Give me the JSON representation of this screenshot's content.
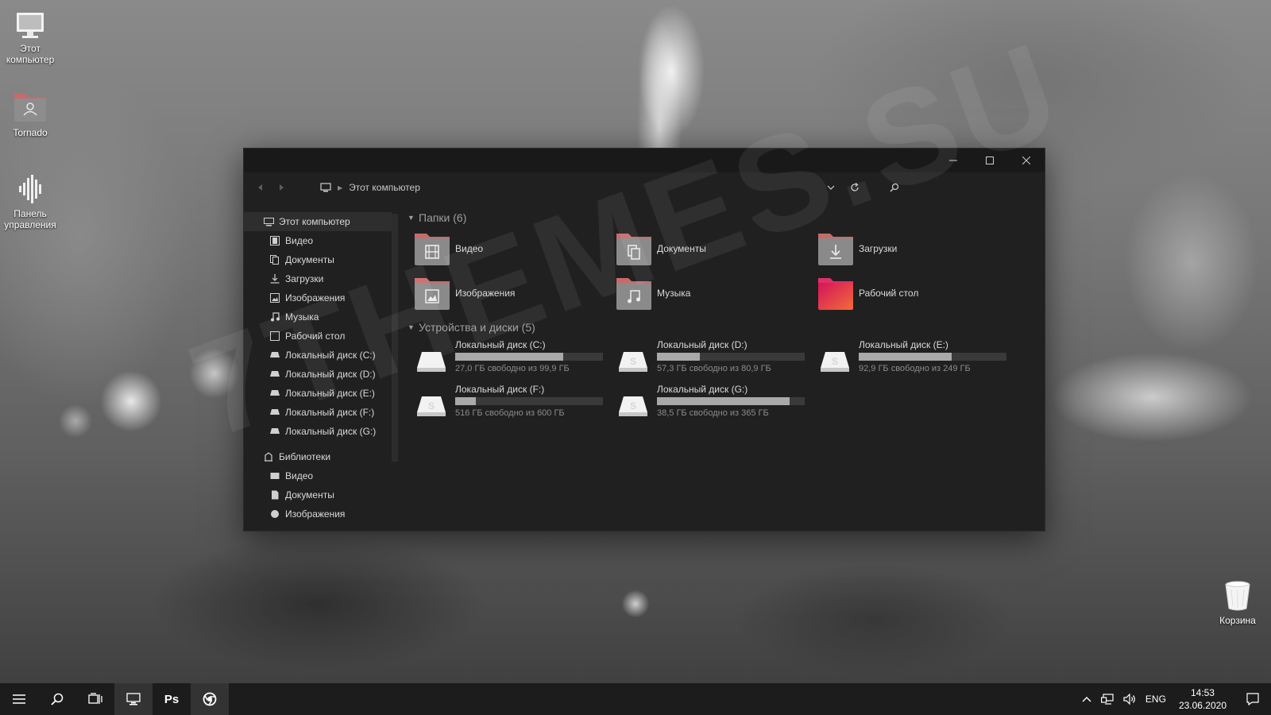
{
  "desktop": {
    "icons": [
      {
        "label": "Этот компьютер"
      },
      {
        "label": "Tornado"
      },
      {
        "label": "Панель управления"
      },
      {
        "label": "Корзина"
      }
    ],
    "watermark": "7THEMES.SU"
  },
  "window": {
    "address": {
      "location": "Этот компьютер"
    },
    "nav": {
      "this_pc": "Этот компьютер",
      "items": [
        {
          "label": "Видео",
          "icon": "video-icon"
        },
        {
          "label": "Документы",
          "icon": "documents-icon"
        },
        {
          "label": "Загрузки",
          "icon": "downloads-icon"
        },
        {
          "label": "Изображения",
          "icon": "images-icon"
        },
        {
          "label": "Музыка",
          "icon": "music-icon"
        },
        {
          "label": "Рабочий стол",
          "icon": "desktop-icon"
        },
        {
          "label": "Локальный диск (C:)",
          "icon": "drive-icon"
        },
        {
          "label": "Локальный диск (D:)",
          "icon": "drive-icon"
        },
        {
          "label": "Локальный диск (E:)",
          "icon": "drive-icon"
        },
        {
          "label": "Локальный диск (F:)",
          "icon": "drive-icon"
        },
        {
          "label": "Локальный диск (G:)",
          "icon": "drive-icon"
        }
      ],
      "libraries": "Библиотеки",
      "library_items": [
        {
          "label": "Видео",
          "icon": "video-icon"
        },
        {
          "label": "Документы",
          "icon": "documents-icon"
        },
        {
          "label": "Изображения",
          "icon": "images-icon"
        }
      ]
    },
    "folders_header": "Папки (6)",
    "folders": [
      {
        "label": "Видео",
        "icon": "video-icon"
      },
      {
        "label": "Документы",
        "icon": "documents-icon"
      },
      {
        "label": "Загрузки",
        "icon": "downloads-icon"
      },
      {
        "label": "Изображения",
        "icon": "images-icon"
      },
      {
        "label": "Музыка",
        "icon": "music-icon"
      },
      {
        "label": "Рабочий стол",
        "icon": "desktop-icon"
      }
    ],
    "devices_header": "Устройства и диски (5)",
    "drives": [
      {
        "name": "Локальный диск (C:)",
        "free": "27,0 ГБ свободно из 99,9 ГБ",
        "used_fraction": 0.73
      },
      {
        "name": "Локальный диск (D:)",
        "free": "57,3 ГБ свободно из 80,9 ГБ",
        "used_fraction": 0.29
      },
      {
        "name": "Локальный диск (E:)",
        "free": "92,9 ГБ свободно из 249 ГБ",
        "used_fraction": 0.63
      },
      {
        "name": "Локальный диск (F:)",
        "free": "516 ГБ свободно из 600 ГБ",
        "used_fraction": 0.14
      },
      {
        "name": "Локальный диск (G:)",
        "free": "38,5 ГБ свободно из 365 ГБ",
        "used_fraction": 0.9
      }
    ]
  },
  "taskbar": {
    "photoshop_label": "Ps",
    "language": "ENG",
    "time": "14:53",
    "date": "23.06.2020"
  },
  "colors": {
    "folder_top": "#c96a6a",
    "folder_body": "#8a8a8a",
    "desktop_folder_start": "#d4145a",
    "desktop_folder_end": "#f26b3a"
  }
}
